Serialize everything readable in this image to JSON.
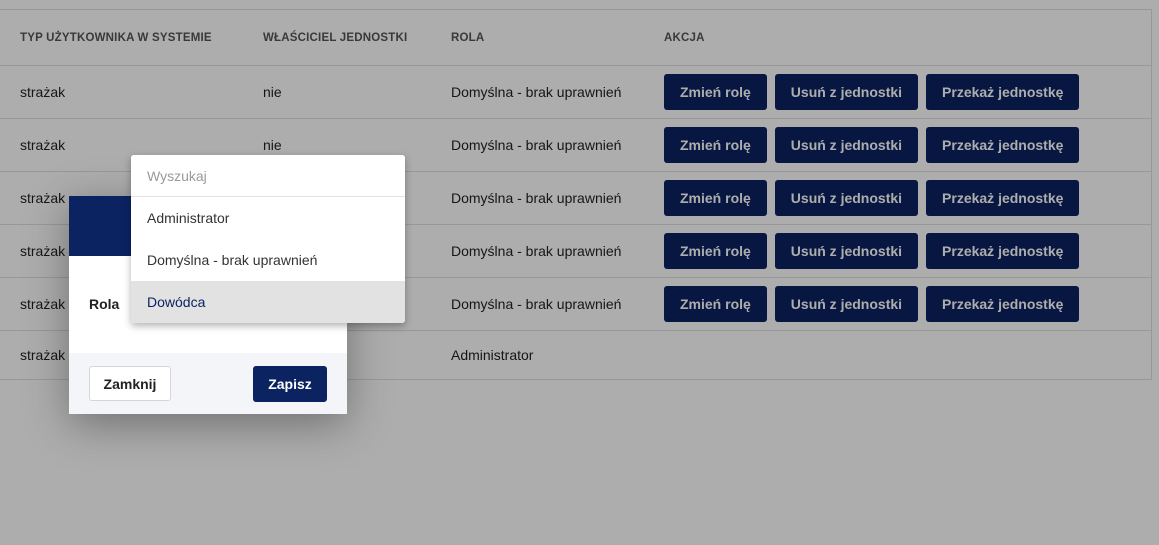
{
  "table": {
    "headers": [
      "TYP UŻYTKOWNIKA W SYSTEMIE",
      "WŁAŚCICIEL JEDNOSTKI",
      "ROLA",
      "AKCJA"
    ],
    "rows": [
      {
        "type": "strażak",
        "owner": "nie",
        "role": "Domyślna - brak uprawnień"
      },
      {
        "type": "strażak",
        "owner": "nie",
        "role": "Domyślna - brak uprawnień"
      },
      {
        "type": "strażak",
        "owner": "",
        "role": "Domyślna - brak uprawnień"
      },
      {
        "type": "strażak",
        "owner": "",
        "role": "Domyślna - brak uprawnień"
      },
      {
        "type": "strażak",
        "owner": "",
        "role": "Domyślna - brak uprawnień"
      },
      {
        "type": "strażak",
        "owner": "",
        "role": "Administrator"
      }
    ],
    "actions": {
      "change_role": "Zmień rolę",
      "remove": "Usuń z jednostki",
      "transfer": "Przekaż jednostkę"
    }
  },
  "modal": {
    "label": "Rola",
    "close_label": "Zamknij",
    "save_label": "Zapisz"
  },
  "dropdown": {
    "search_placeholder": "Wyszukaj",
    "options": [
      "Administrator",
      "Domyślna - brak uprawnień",
      "Dowódca"
    ],
    "selected": "Dowódca"
  },
  "colors": {
    "primary": "#0b2361",
    "overlay": "rgba(0,0,0,0.32)"
  }
}
